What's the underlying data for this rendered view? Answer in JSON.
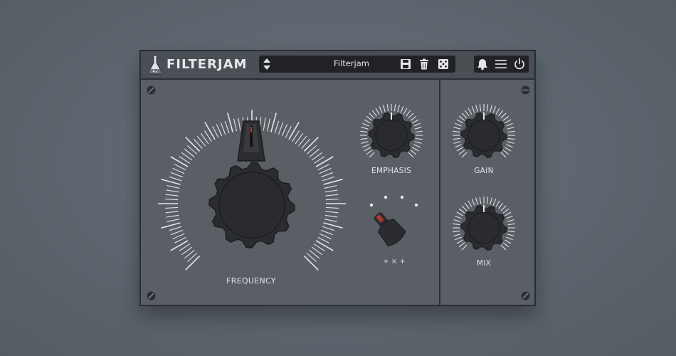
{
  "header": {
    "brand": "FILTERJAM",
    "preset_name": "Filterjam"
  },
  "controls": {
    "frequency": {
      "label": "FREQUENCY"
    },
    "emphasis": {
      "label": "EMPHASIS"
    },
    "gain": {
      "label": "GAIN"
    },
    "mix": {
      "label": "MIX"
    },
    "mode_switch": {
      "label": "+ × +"
    }
  },
  "icons": {
    "preset_arrows": "up-down-arrows-icon",
    "save": "save-icon",
    "delete": "trash-icon",
    "random": "dice-icon",
    "notify": "bell-icon",
    "menu": "hamburger-menu-icon",
    "power": "power-icon",
    "logo": "flask-icon"
  },
  "colors": {
    "panel": "#5a5f66",
    "header": "#4a4e55",
    "knob": "#2a2b2d",
    "tick": "#e8e8e8",
    "pointer": "#c0392b"
  }
}
